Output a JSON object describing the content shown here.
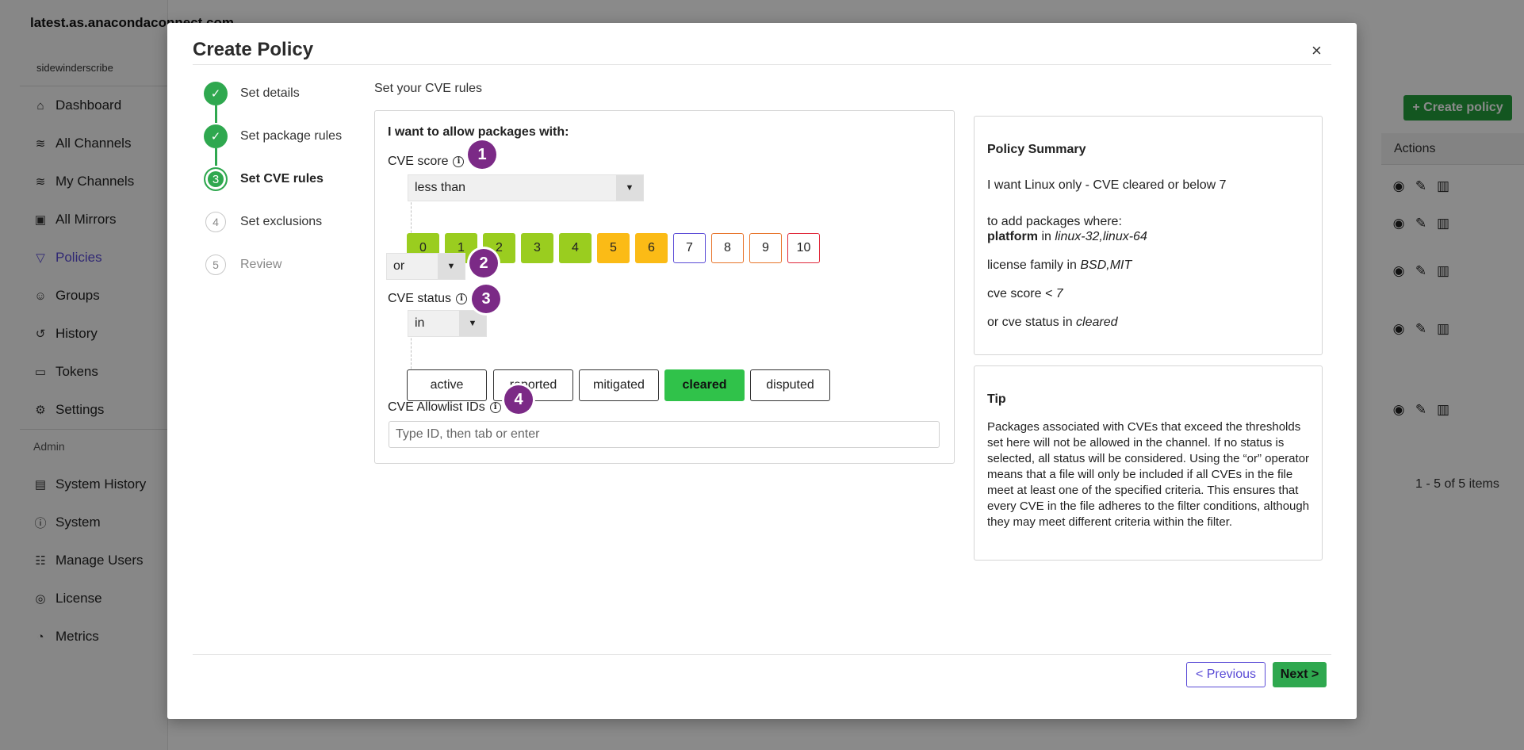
{
  "app": {
    "site_name": "latest.as.anacondaconnect.com",
    "site_sub": "sidewinderscribe",
    "nav": [
      {
        "label": "Dashboard",
        "icon": "home-icon"
      },
      {
        "label": "All Channels",
        "icon": "channels-icon"
      },
      {
        "label": "My Channels",
        "icon": "channels-icon"
      },
      {
        "label": "All Mirrors",
        "icon": "mirror-icon"
      },
      {
        "label": "Policies",
        "icon": "filter-icon",
        "active": true
      },
      {
        "label": "Groups",
        "icon": "users-icon"
      },
      {
        "label": "History",
        "icon": "history-icon"
      },
      {
        "label": "Tokens",
        "icon": "token-icon"
      },
      {
        "label": "Settings",
        "icon": "gear-icon"
      }
    ],
    "admin_label": "Admin",
    "admin_nav": [
      {
        "label": "System History",
        "icon": "system-history-icon"
      },
      {
        "label": "System",
        "icon": "info-icon"
      },
      {
        "label": "Manage Users",
        "icon": "manage-users-icon"
      },
      {
        "label": "License",
        "icon": "license-icon"
      },
      {
        "label": "Metrics",
        "icon": "chart-pie-icon"
      }
    ],
    "create_policy_label": "+ Create policy",
    "table_actions_header": "Actions",
    "pager_text": "1 - 5 of 5 items"
  },
  "modal": {
    "title": "Create Policy",
    "close_label": "×",
    "steps": [
      {
        "num": "1",
        "label": "Set details",
        "state": "done"
      },
      {
        "num": "2",
        "label": "Set package rules",
        "state": "done"
      },
      {
        "num": "3",
        "label": "Set CVE rules",
        "state": "current"
      },
      {
        "num": "4",
        "label": "Set exclusions",
        "state": "todo"
      },
      {
        "num": "5",
        "label": "Review",
        "state": "todo"
      }
    ],
    "section_title": "Set your CVE rules",
    "rules_heading": "I want to allow packages with:",
    "cve_score": {
      "label": "CVE score",
      "operator": "less than",
      "scores": [
        "0",
        "1",
        "2",
        "3",
        "4",
        "5",
        "6",
        "7",
        "8",
        "9",
        "10"
      ]
    },
    "join_operator": "or",
    "cve_status": {
      "label": "CVE status",
      "operator": "in",
      "options": [
        "active",
        "reported",
        "mitigated",
        "cleared",
        "disputed"
      ],
      "selected": "cleared"
    },
    "allowlist": {
      "label": "CVE Allowlist IDs",
      "placeholder": "Type ID, then tab or enter"
    },
    "badges": [
      "1",
      "2",
      "3",
      "4"
    ],
    "summary": {
      "heading": "Policy Summary",
      "intro_prefix": "I want ",
      "intro_name": "Linux only - CVE cleared or below 7",
      "lines_head": "to add packages where:",
      "platform_key": "platform",
      "platform_in": " in ",
      "platform_val": "linux-32,linux-64",
      "license_key": "license family in ",
      "license_val": "BSD,MIT",
      "cve_score_key": "cve score ",
      "cve_score_val": "< 7",
      "cve_status_key": "or cve status in ",
      "cve_status_val": "cleared"
    },
    "tip": {
      "heading": "Tip",
      "text": "Packages associated with CVEs that exceed the thresholds set here will not be allowed in the channel. If no status is selected, all status will be considered. Using the “or” operator means that a file will only be included if all CVEs in the file meet at least one of the specified criteria. This ensures that every CVE in the file adheres to the filter conditions, although they may meet different criteria within the filter."
    },
    "prev_label": "< Previous",
    "next_label": "Next >"
  },
  "colors": {
    "score_green": "#9acd1f",
    "score_amber": "#fbbb16",
    "score_7_border": "#5a4bd6",
    "score_8_9_border": "#e8742a",
    "score_10_border": "#e0283a",
    "status_selected": "#30c24a",
    "badge": "#7b2a86",
    "accent": "#5a4bd6"
  }
}
